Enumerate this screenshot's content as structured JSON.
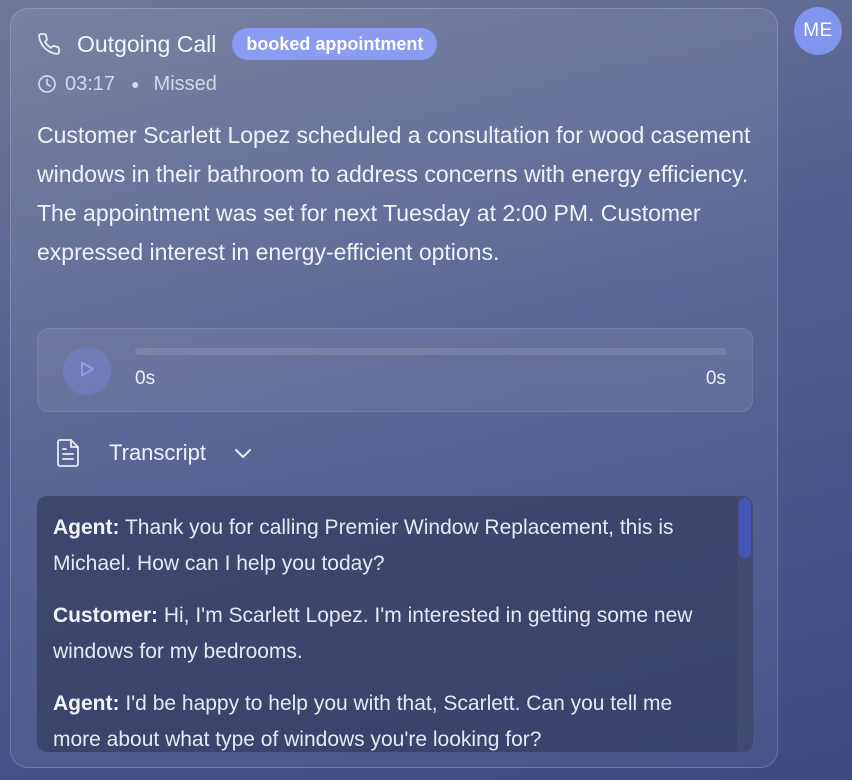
{
  "avatar": {
    "initials": "ME"
  },
  "call": {
    "title": "Outgoing Call",
    "badge": "booked appointment",
    "duration": "03:17",
    "status": "Missed",
    "summary": "Customer Scarlett Lopez scheduled a consultation for wood casement windows in their bathroom to address concerns with energy efficiency. The appointment was set for next Tuesday at 2:00 PM. Customer expressed interest in energy-efficient options."
  },
  "player": {
    "current_time": "0s",
    "total_time": "0s",
    "progress": 0
  },
  "transcript": {
    "label": "Transcript",
    "lines": [
      {
        "speaker": "Agent:",
        "text": " Thank you for calling Premier Window Replacement, this is Michael. How can I help you today?"
      },
      {
        "speaker": "Customer:",
        "text": " Hi, I'm Scarlett Lopez. I'm interested in getting some new windows for my bedrooms."
      },
      {
        "speaker": "Agent:",
        "text": " I'd be happy to help you with that, Scarlett. Can you tell me more about what type of windows you're looking for?"
      }
    ]
  },
  "icons": {
    "phone": "phone-icon",
    "clock": "clock-icon",
    "play": "play-icon",
    "document": "document-icon",
    "chevron": "chevron-down-icon"
  },
  "colors": {
    "badge": "#8a9cf2",
    "avatar": "#7f95ee",
    "scroll_thumb": "#4456b8"
  }
}
